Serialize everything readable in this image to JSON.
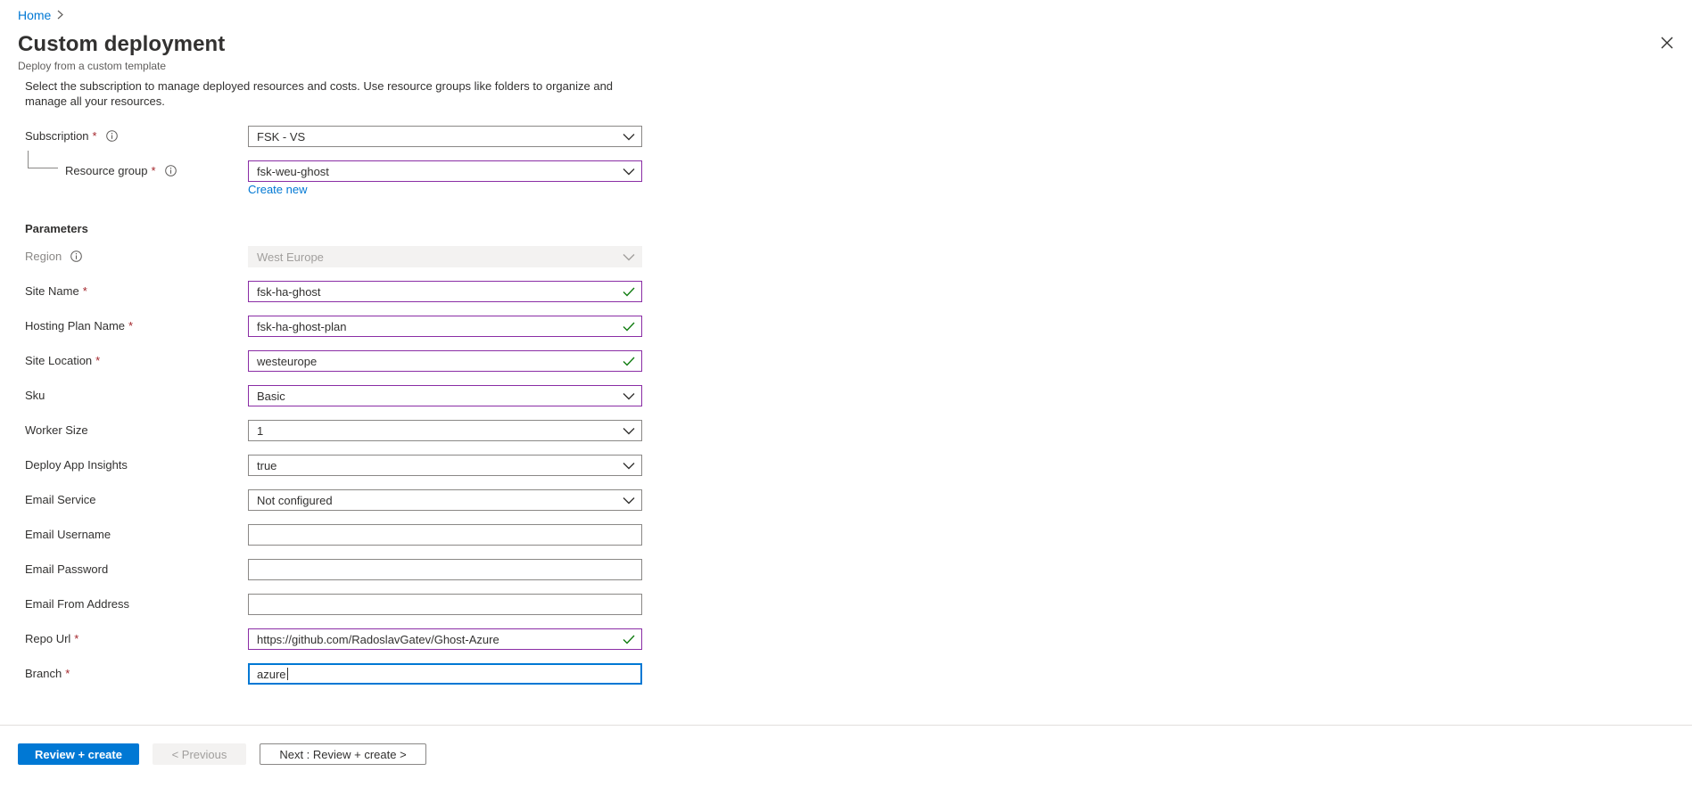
{
  "header": {
    "breadcrumb": [
      "Home"
    ],
    "title": "Custom deployment",
    "subtitle": "Deploy from a custom template"
  },
  "intro_text": "Select the subscription to manage deployed resources and costs. Use resource groups like folders to organize and manage all your resources.",
  "project": {
    "subscription": {
      "label": "Subscription",
      "value": "FSK - VS"
    },
    "resource_group": {
      "label": "Resource group",
      "value": "fsk-weu-ghost",
      "create_new": "Create new"
    }
  },
  "parameters_title": "Parameters",
  "fields": {
    "region": {
      "label": "Region",
      "value": "West Europe"
    },
    "site_name": {
      "label": "Site Name",
      "value": "fsk-ha-ghost"
    },
    "hosting_plan_name": {
      "label": "Hosting Plan Name",
      "value": "fsk-ha-ghost-plan"
    },
    "site_location": {
      "label": "Site Location",
      "value": "westeurope"
    },
    "sku": {
      "label": "Sku",
      "value": "Basic"
    },
    "worker_size": {
      "label": "Worker Size",
      "value": "1"
    },
    "deploy_app_insights": {
      "label": "Deploy App Insights",
      "value": "true"
    },
    "email_service": {
      "label": "Email Service",
      "value": "Not configured"
    },
    "email_username": {
      "label": "Email Username",
      "value": ""
    },
    "email_password": {
      "label": "Email Password",
      "value": ""
    },
    "email_from_address": {
      "label": "Email From Address",
      "value": ""
    },
    "repo_url": {
      "label": "Repo Url",
      "value": "https://github.com/RadoslavGatev/Ghost-Azure"
    },
    "branch": {
      "label": "Branch",
      "value": "azure"
    }
  },
  "required_marker": "*",
  "footer": {
    "review_create": "Review + create",
    "previous": "< Previous",
    "next": "Next : Review + create >"
  },
  "colors": {
    "accent": "#0078d4",
    "valid_border": "#8a2da5",
    "check": "#107c10",
    "required": "#a4262c"
  }
}
